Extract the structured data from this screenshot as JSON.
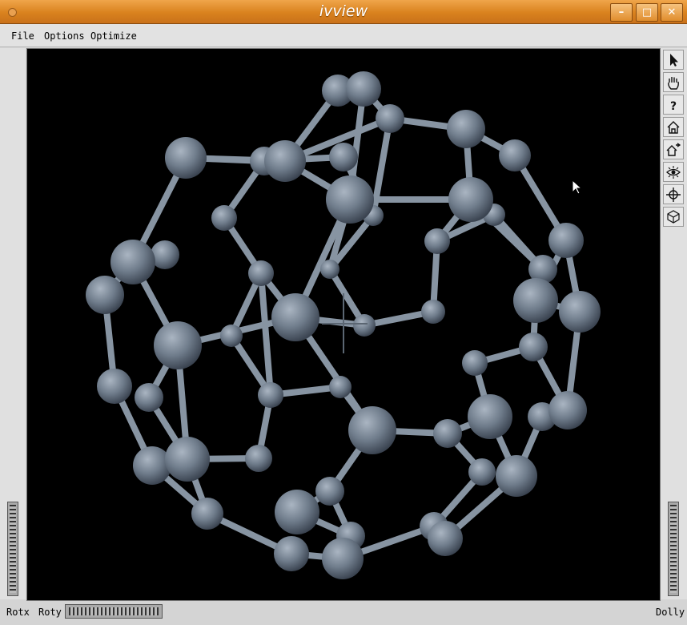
{
  "window": {
    "title": "ivview"
  },
  "menu": {
    "file": "File",
    "options": "Options",
    "optimize": "Optimize"
  },
  "toolbar": {
    "help": "?"
  },
  "status": {
    "rotx": "Rotx",
    "roty": "Roty",
    "dolly": "Dolly"
  },
  "viewport": {
    "background": "#000000",
    "atom_color": "#7d8a99",
    "bond_color": "#8794a2"
  }
}
